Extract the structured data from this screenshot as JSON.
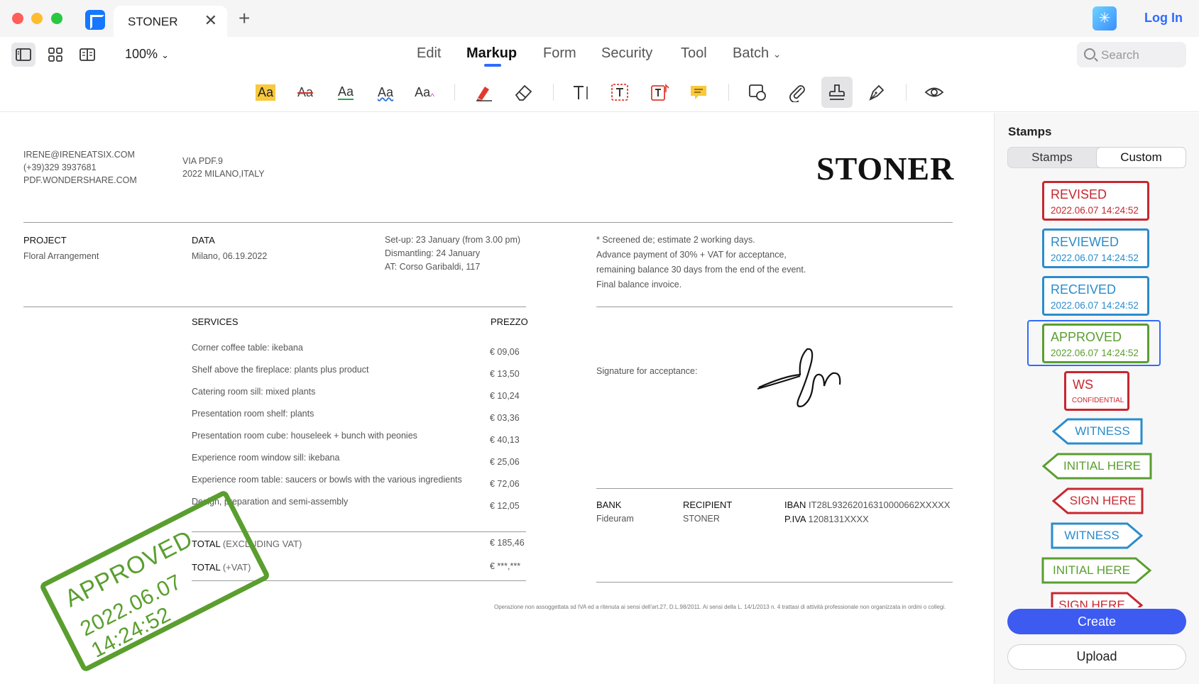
{
  "window": {
    "tab_title": "STONER",
    "tab_close": "✕",
    "new_tab": "+",
    "login": "Log In",
    "ai_icon": "✳"
  },
  "menubar": {
    "zoom": "100%",
    "items": [
      "Edit",
      "Markup",
      "Form",
      "Security",
      "Tool",
      "Batch"
    ],
    "active": "Markup",
    "search_placeholder": "Search"
  },
  "toolbar": {
    "text_tools": [
      "Aa",
      "Aa",
      "Aa",
      "Aa",
      "Aa"
    ]
  },
  "document": {
    "contact": [
      "IRENE@IRENEATSIX.COM",
      "(+39)329 3937681",
      "PDF.WONDERSHARE.COM"
    ],
    "address": [
      "VIA PDF.9",
      "2022 MILANO,ITALY"
    ],
    "brand": "STONER",
    "project_label": "PROJECT",
    "project_value": "Floral Arrangement",
    "data_label": "DATA",
    "data_value": "Milano, 06.19.2022",
    "setup": [
      "Set-up: 23 January (from 3.00 pm)",
      "Dismantling: 24 January",
      "AT: Corso Garibaldi, 117"
    ],
    "notes": [
      "* Screened de; estimate 2 working days.",
      "Advance payment of 30% + VAT for acceptance,",
      "remaining balance 30 days from the end of the event.",
      "Final balance invoice."
    ],
    "services_label": "SERVICES",
    "prezzo_label": "PREZZO",
    "services": [
      {
        "name": "Corner coffee table: ikebana",
        "price": "€ 09,06"
      },
      {
        "name": "Shelf above the fireplace: plants plus product",
        "price": "€ 13,50"
      },
      {
        "name": "Catering room sill: mixed plants",
        "price": "€ 10,24"
      },
      {
        "name": "Presentation room shelf: plants",
        "price": "€ 03,36"
      },
      {
        "name": "Presentation room cube: houseleek + bunch with peonies",
        "price": "€ 40,13"
      },
      {
        "name": "Experience room window sill: ikebana",
        "price": "€ 25,06"
      },
      {
        "name": "Experience room table: saucers or bowls with the various ingredients",
        "price": "€ 72,06"
      },
      {
        "name": "Design, preparation and semi-assembly",
        "price": "€ 12,05"
      }
    ],
    "total_label": "TOTAL",
    "total_excl_note": "(EXCLUDING VAT)",
    "total_excl_value": "€ 185,46",
    "total_vat_note": "(+VAT)",
    "total_vat_value": "€ ***,***",
    "signature_label": "Signature for acceptance:",
    "bank_label": "BANK",
    "bank_value": "Fideuram",
    "recipient_label": "RECIPIENT",
    "recipient_value": "STONER",
    "iban_label": "IBAN",
    "iban_value": "IT28L93262016310000662XXXXX",
    "piva_label": "P.IVA",
    "piva_value": "1208131XXXX",
    "footer": "Operazione non assoggettata sd IVA ed a ritenuta ai sensi dell'art.27, D.L.98/2011. Ai sensi della L. 14/1/2013 n. 4 trattasi di attività professionale non organizzata in ordini o collegi.",
    "stamp": {
      "title": "APPROVED",
      "date": "2022.06.07 14:24:52",
      "color": "#5a9e2f"
    }
  },
  "panel": {
    "title": "Stamps",
    "tab_stamps": "Stamps",
    "tab_custom": "Custom",
    "boxed_stamps": [
      {
        "title": "REVISED",
        "date": "2022.06.07 14:24:52",
        "color": "#c8272f"
      },
      {
        "title": "REVIEWED",
        "date": "2022.06.07 14:24:52",
        "color": "#2a8ccc"
      },
      {
        "title": "RECEIVED",
        "date": "2022.06.07 14:24:52",
        "color": "#2a8ccc"
      },
      {
        "title": "APPROVED",
        "date": "2022.06.07 14:24:52",
        "color": "#5a9e2f"
      }
    ],
    "ws_stamp": {
      "title": "WS",
      "subtitle": "CONFIDENTIAL",
      "color": "#c8272f"
    },
    "arrow_stamps": [
      {
        "label": "WITNESS",
        "color": "#2a8ccc"
      },
      {
        "label": "INITIAL HERE",
        "color": "#5a9e2f"
      },
      {
        "label": "SIGN HERE",
        "color": "#c8272f"
      },
      {
        "label": "WITNESS",
        "color": "#2a8ccc"
      },
      {
        "label": "INITIAL HERE",
        "color": "#5a9e2f"
      },
      {
        "label": "SIGN HERE",
        "color": "#c8272f"
      }
    ],
    "create_label": "Create",
    "upload_label": "Upload"
  },
  "colors": {
    "accent": "#2e6bff",
    "create": "#3d5af1"
  }
}
